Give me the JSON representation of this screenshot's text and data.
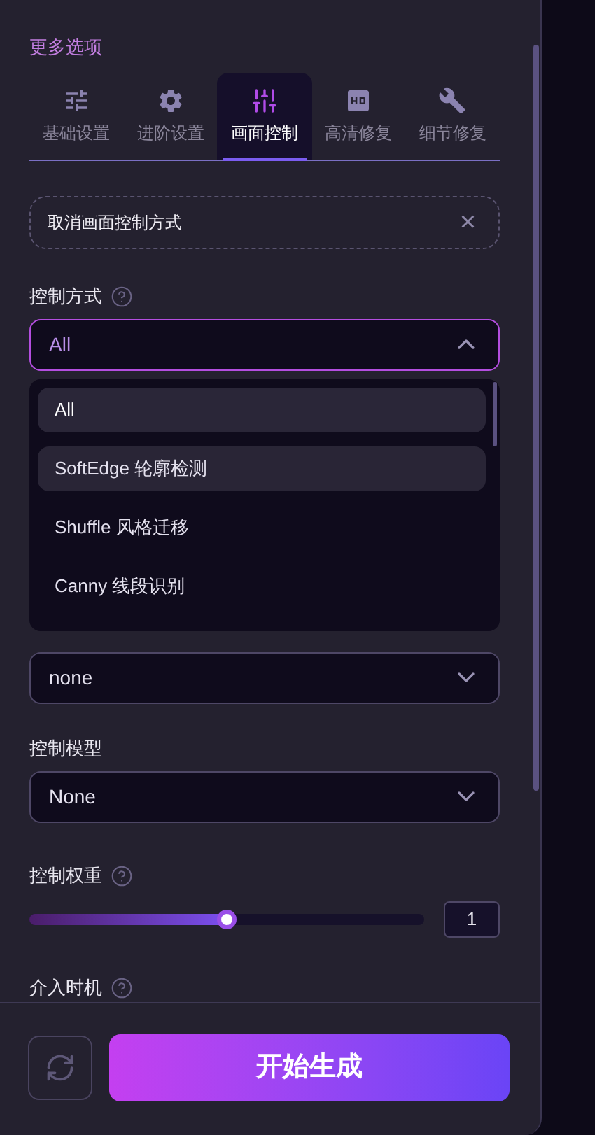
{
  "section_title": "更多选项",
  "tabs": [
    {
      "label": "基础设置",
      "selected": false
    },
    {
      "label": "进阶设置",
      "selected": false
    },
    {
      "label": "画面控制",
      "selected": true
    },
    {
      "label": "高清修复",
      "selected": false
    },
    {
      "label": "细节修复",
      "selected": false
    }
  ],
  "cancel_button": {
    "label": "取消画面控制方式",
    "close": "×"
  },
  "fields": [
    {
      "label": "控制方式",
      "help": true,
      "value": "All",
      "open": true
    },
    {
      "help": false,
      "value": "none",
      "open": false
    },
    {
      "label": "控制模型",
      "help": false,
      "value": "None",
      "open": false
    }
  ],
  "dropdown_options": [
    {
      "label": "All",
      "selected": true,
      "hovered": false
    },
    {
      "label": "SoftEdge 轮廓检测",
      "selected": false,
      "hovered": true
    },
    {
      "label": "Shuffle 风格迁移",
      "selected": false,
      "hovered": false
    },
    {
      "label": "Canny 线段识别",
      "selected": false,
      "hovered": false
    }
  ],
  "weight": {
    "label": "控制权重",
    "level": 0.5,
    "value": "1"
  },
  "timing": {
    "label": "介入时机"
  },
  "generate_button": "开始生成"
}
